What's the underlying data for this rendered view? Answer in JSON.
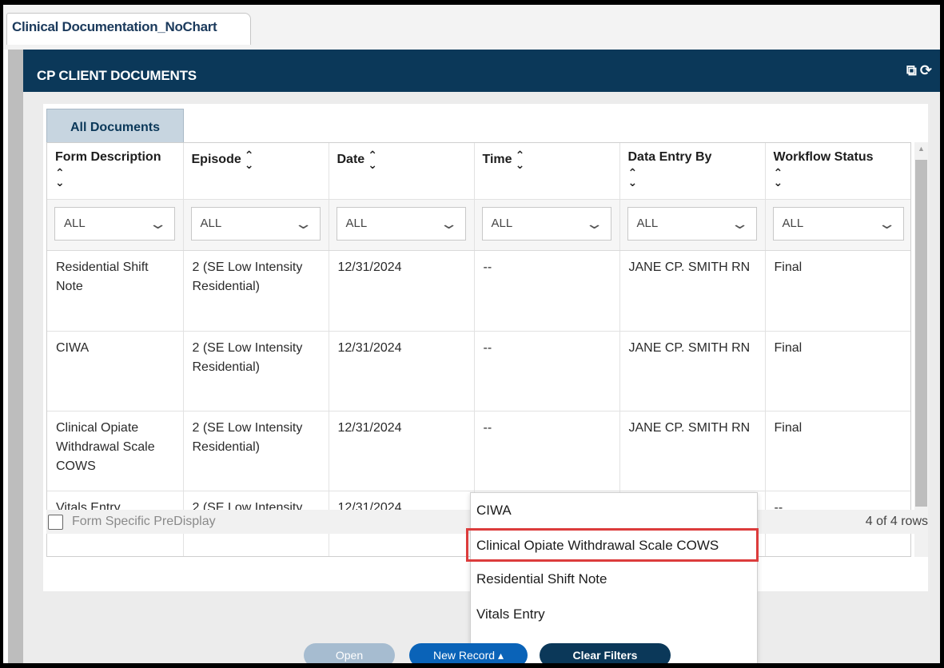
{
  "window_tab": {
    "label": "Clinical Documentation_NoChart"
  },
  "panel": {
    "title": "CP CLIENT DOCUMENTS",
    "icons": [
      "popout-icon",
      "refresh-icon"
    ]
  },
  "subtab": {
    "label": "All Documents"
  },
  "table": {
    "columns": [
      {
        "label": "Form Description"
      },
      {
        "label": "Episode"
      },
      {
        "label": "Date"
      },
      {
        "label": "Time"
      },
      {
        "label": "Data Entry By"
      },
      {
        "label": "Workflow Status"
      }
    ],
    "filters": [
      "ALL",
      "ALL",
      "ALL",
      "ALL",
      "ALL",
      "ALL"
    ],
    "rows": [
      [
        "Residential Shift Note",
        "2 (SE Low Intensity Residential)",
        "12/31/2024",
        "--",
        "JANE CP. SMITH RN",
        "Final"
      ],
      [
        "CIWA",
        "2 (SE Low Intensity Residential)",
        "12/31/2024",
        "--",
        "JANE CP. SMITH RN",
        "Final"
      ],
      [
        "Clinical Opiate Withdrawal Scale COWS",
        "2 (SE Low Intensity Residential)",
        "12/31/2024",
        "--",
        "JANE CP. SMITH RN",
        "Final"
      ],
      [
        "Vitals Entry",
        "2 (SE Low Intensity",
        "12/31/2024",
        "",
        "",
        "--"
      ]
    ]
  },
  "footer": {
    "checkbox_label": "Form Specific PreDisplay",
    "row_count": "4 of 4 rows"
  },
  "new_record_menu": {
    "items": [
      "CIWA",
      "Clinical Opiate Withdrawal Scale COWS",
      "Residential Shift Note",
      "Vitals Entry"
    ],
    "highlighted_index": 1,
    "highlight_color": "#dc3c3c"
  },
  "buttons": {
    "open": "Open",
    "new_record": "New Record",
    "clear_filters": "Clear Filters"
  },
  "colors": {
    "header_bg": "#0b3859",
    "primary_button": "#0a63b8",
    "disabled_button": "#a6bcd0"
  }
}
